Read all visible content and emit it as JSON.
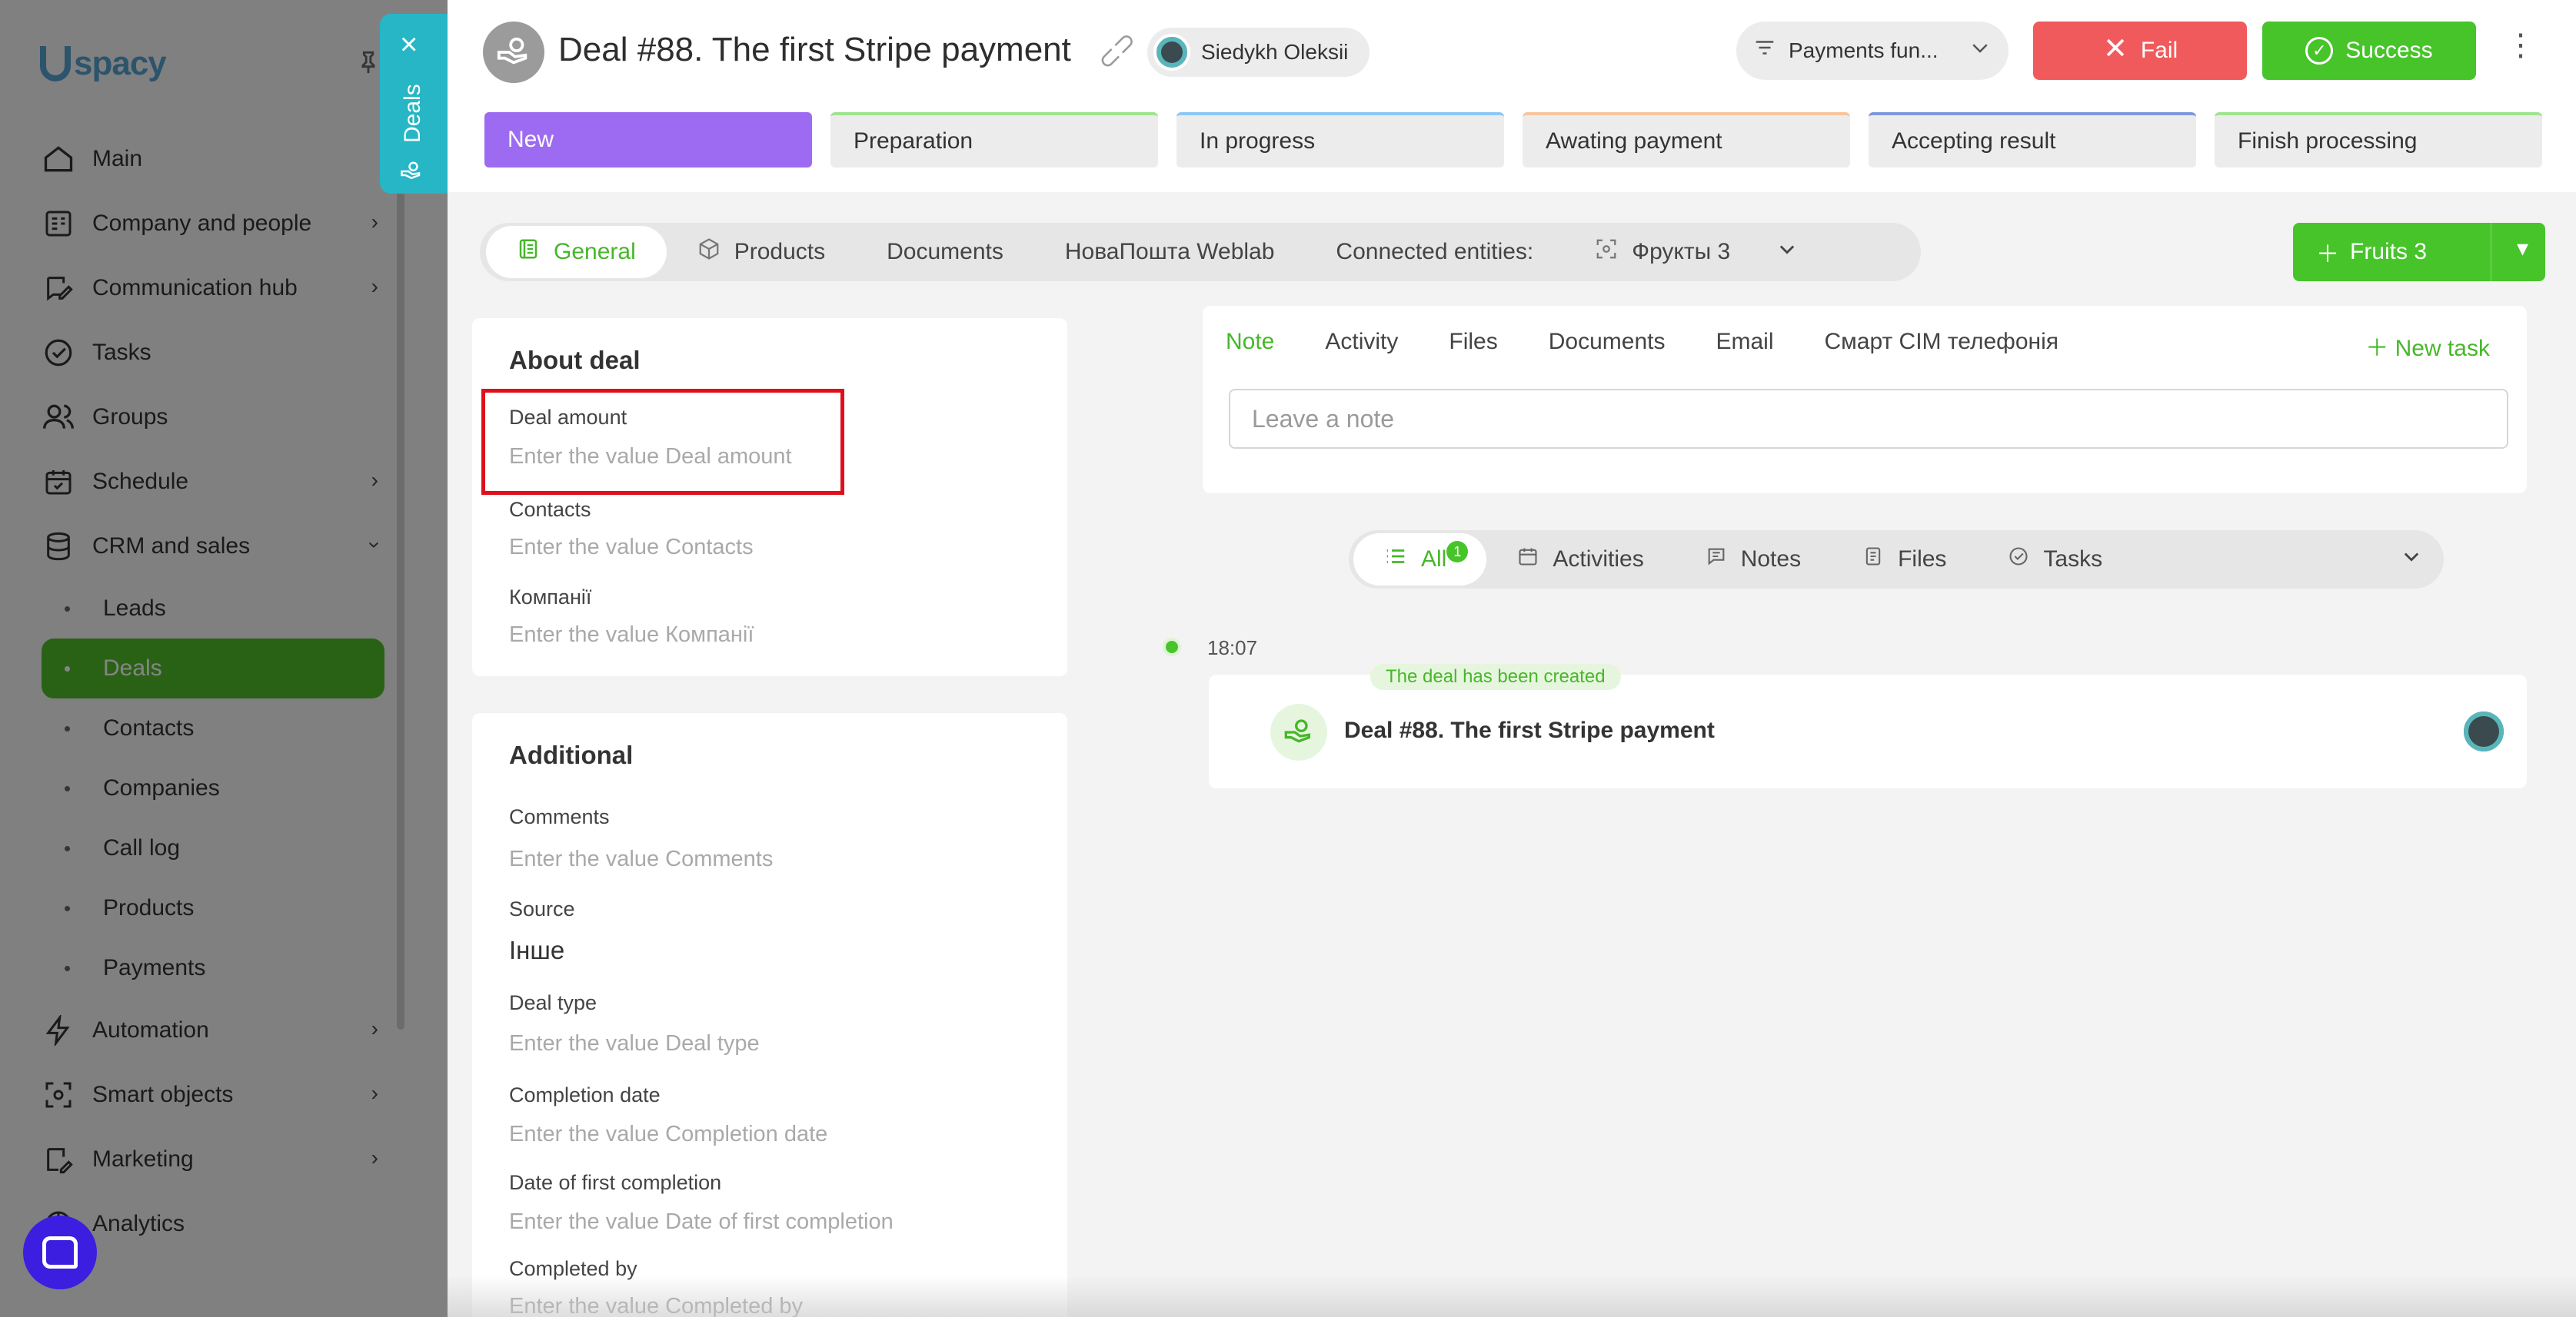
{
  "sidebar": {
    "logo": "spacy",
    "items": [
      {
        "label": "Main",
        "icon": "home-icon"
      },
      {
        "label": "Company and people",
        "icon": "building-icon",
        "chevron": true
      },
      {
        "label": "Communication hub",
        "icon": "chat-edit-icon",
        "chevron": true
      },
      {
        "label": "Tasks",
        "icon": "check-circle-icon"
      },
      {
        "label": "Groups",
        "icon": "users-icon"
      },
      {
        "label": "Schedule",
        "icon": "calendar-icon",
        "chevron": true
      },
      {
        "label": "CRM and sales",
        "icon": "database-icon",
        "expanded": true
      }
    ],
    "crm_sub": [
      "Leads",
      "Deals",
      "Contacts",
      "Companies",
      "Call log",
      "Products",
      "Payments"
    ],
    "items_after": [
      {
        "label": "Automation",
        "icon": "lightning-icon",
        "chevron": true
      },
      {
        "label": "Smart objects",
        "icon": "smart-object-icon",
        "chevron": true
      },
      {
        "label": "Marketing",
        "icon": "marketing-icon",
        "chevron": true
      },
      {
        "label": "Analytics",
        "icon": "analytics-icon"
      }
    ]
  },
  "deals_tab": {
    "label": "Deals"
  },
  "header": {
    "title": "Deal #88. The first Stripe payment",
    "user": "Siedykh Oleksii",
    "funnel": "Payments fun...",
    "fail_label": "Fail",
    "success_label": "Success"
  },
  "stages": [
    {
      "label": "New",
      "color": "#9d6bf1",
      "current": true
    },
    {
      "label": "Preparation",
      "color": "#9fe48e"
    },
    {
      "label": "In progress",
      "color": "#8cc7f5"
    },
    {
      "label": "Awating payment",
      "color": "#f8c59c"
    },
    {
      "label": "Accepting result",
      "color": "#7f97dc"
    },
    {
      "label": "Finish processing",
      "color": "#9fe48e"
    }
  ],
  "tabs": [
    "General",
    "Products",
    "Documents",
    "НоваПошта Weblab",
    "Connected entities:",
    "Фрукты 3"
  ],
  "fruits_button": "Fruits 3",
  "about": {
    "title": "About deal",
    "fields": [
      {
        "label": "Deal amount",
        "value": "Enter the value Deal amount"
      },
      {
        "label": "Contacts",
        "value": "Enter the value Contacts"
      },
      {
        "label": "Компанії",
        "value": "Enter the value Компанії"
      }
    ]
  },
  "additional": {
    "title": "Additional",
    "fields": [
      {
        "label": "Comments",
        "value": "Enter the value Comments"
      },
      {
        "label": "Source",
        "value": "Інше"
      },
      {
        "label": "Deal type",
        "value": "Enter the value Deal type"
      },
      {
        "label": "Completion date",
        "value": "Enter the value Completion date"
      },
      {
        "label": "Date of first completion",
        "value": "Enter the value Date of first completion"
      },
      {
        "label": "Completed by",
        "value": "Enter the value Completed by"
      }
    ]
  },
  "composer": {
    "tabs": [
      "Note",
      "Activity",
      "Files",
      "Documents",
      "Email",
      "Смарт СІМ телефонія"
    ],
    "new_task": "New task",
    "placeholder": "Leave a note"
  },
  "filters": {
    "items": [
      "All",
      "Activities",
      "Notes",
      "Files",
      "Tasks"
    ],
    "all_badge": "1"
  },
  "timeline": {
    "time": "18:07",
    "chip": "The deal has been created",
    "text": "Deal #88. The first Stripe payment"
  },
  "colors": {
    "accent": "#47c42a",
    "fail": "#f15a5c",
    "stage_current": "#9d6bf1",
    "deals_tab": "#26b6c6"
  }
}
